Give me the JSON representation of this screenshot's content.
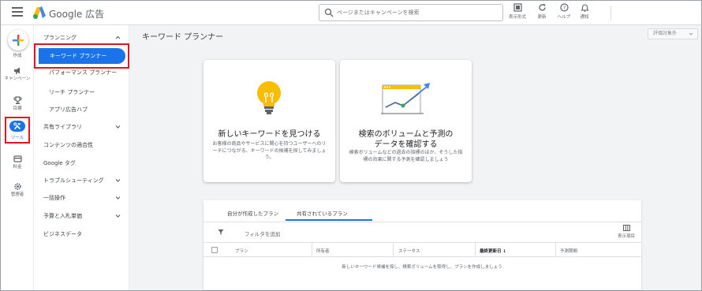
{
  "header": {
    "brand": "Google 広告",
    "search_placeholder": "ページまたはキャンペーンを検索",
    "actions": [
      {
        "label": "表示形式",
        "icon": "display-format-icon"
      },
      {
        "label": "更新",
        "icon": "refresh-icon"
      },
      {
        "label": "ヘルプ",
        "icon": "help-icon"
      },
      {
        "label": "通知",
        "icon": "bell-icon"
      }
    ]
  },
  "rail": {
    "create": "作成",
    "campaigns": "キャンペーン",
    "goals": "目標",
    "tools": "ツール",
    "billing": "料金",
    "admin": "管理者"
  },
  "nav": {
    "planning": "プランニング",
    "keyword_planner": "キーワード プランナー",
    "performance_planner": "パフォーマンス プランナー",
    "reach_planner": "リーチ プランナー",
    "app_hub": "アプリ広告ハブ",
    "shared_library": "共有ライブラリ",
    "content_suitability": "コンテンツの適合性",
    "google_tag": "Google タグ",
    "troubleshooting": "トラブルシューティング",
    "bulk_actions": "一括操作",
    "budgets_bidding": "予算と入札単価",
    "business_data": "ビジネスデータ"
  },
  "main": {
    "page_title": "キーワード プランナー",
    "filter_pill": "評価対象外",
    "card1": {
      "title": "新しいキーワードを見つける",
      "desc": "お客様の商品やサービスに関心を持つユーザーへのリーチにつながる、キーワードの候補を探してみましょう。"
    },
    "card2": {
      "title": "検索のボリュームと予測のデータを確認する",
      "desc": "検索ボリュームなどの過去の指標のほか、そうした指標の効果に関する予測を確認しましょう"
    },
    "plans": {
      "tab_mine": "自分が作成したプラン",
      "tab_shared": "共有されているプラン",
      "add_filter": "フィルタを追加",
      "columns": "表示項目",
      "headers": {
        "plan": "プラン",
        "owner": "所有者",
        "status": "ステータス",
        "last_updated": "最終更新日 ↓",
        "forecast_period": "予測期間"
      },
      "empty_message": "新しいキーワード候補を探し、検索ボリュームを取得し、プランを作成しましょう"
    }
  },
  "colors": {
    "accent": "#1a73e8",
    "highlight": "#e5131e",
    "bulb": "#fbbc04"
  }
}
